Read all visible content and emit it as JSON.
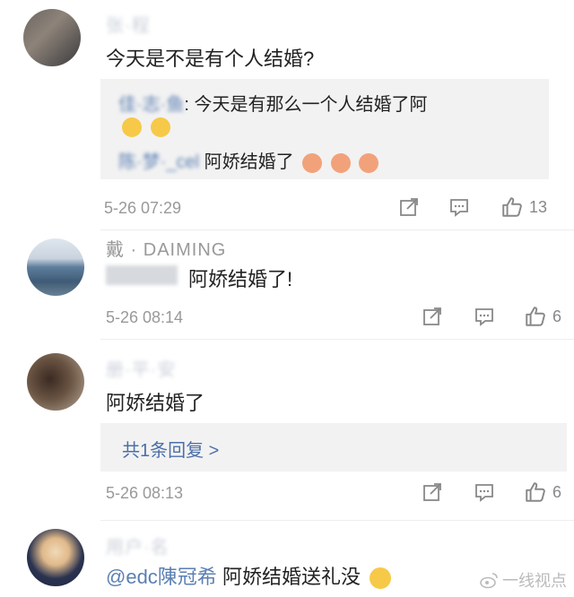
{
  "comments": [
    {
      "username": "张·程",
      "text": "今天是不是有个人结婚?",
      "replies": [
        {
          "user": "佳·志·鱼",
          "text": ": 今天是有那么一个人结婚了阿"
        },
        {
          "user": "陈·梦·_cel",
          "text": "阿娇结婚了"
        }
      ],
      "time": "5-26 07:29",
      "likes": "13"
    },
    {
      "username": "戴 · DAIMING",
      "text": "阿娇结婚了!",
      "time": "5-26 08:14",
      "likes": "6"
    },
    {
      "username": "册·平·安",
      "text": "阿娇结婚了",
      "more_replies": "共1条回复 >",
      "time": "5-26 08:13",
      "likes": "6"
    },
    {
      "username": "用户·名",
      "mention": "@edc陳冠希",
      "text": "阿娇结婚送礼没"
    }
  ],
  "watermark": "一线视点",
  "icons": {
    "share": "share-icon",
    "comment": "comment-icon",
    "like": "thumbs-up-icon"
  },
  "colors": {
    "link": "#5b7fb3",
    "reply_bg": "#f2f2f2",
    "meta": "#999999"
  }
}
